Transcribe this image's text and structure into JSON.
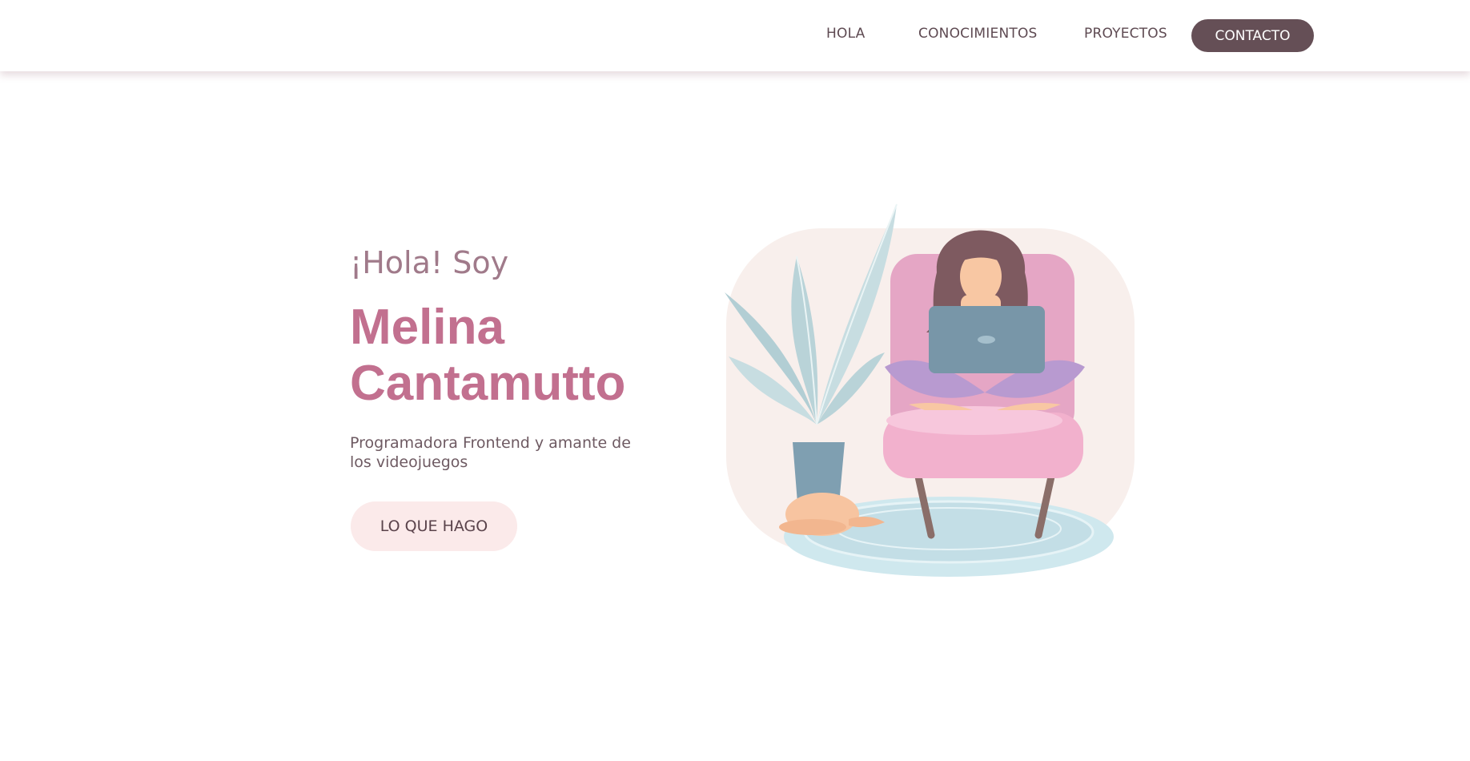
{
  "nav": {
    "links": [
      "HOLA",
      "CONOCIMIENTOS",
      "PROYECTOS"
    ],
    "cta_label": "CONTACTO"
  },
  "hero": {
    "greeting": "¡Hola! Soy",
    "name_line1": "Melina",
    "name_line2": "Cantamutto",
    "tagline": "Programadora Frontend y amante de los videojuegos",
    "button_label": "LO QUE HAGO"
  },
  "colors": {
    "accent": "#c2708f",
    "nav_cta_bg": "#654f56",
    "button_bg": "#fbeaea",
    "text_muted": "#6e5a62"
  },
  "illustration": {
    "icon": "woman-with-laptop-on-armchair-illustration"
  }
}
